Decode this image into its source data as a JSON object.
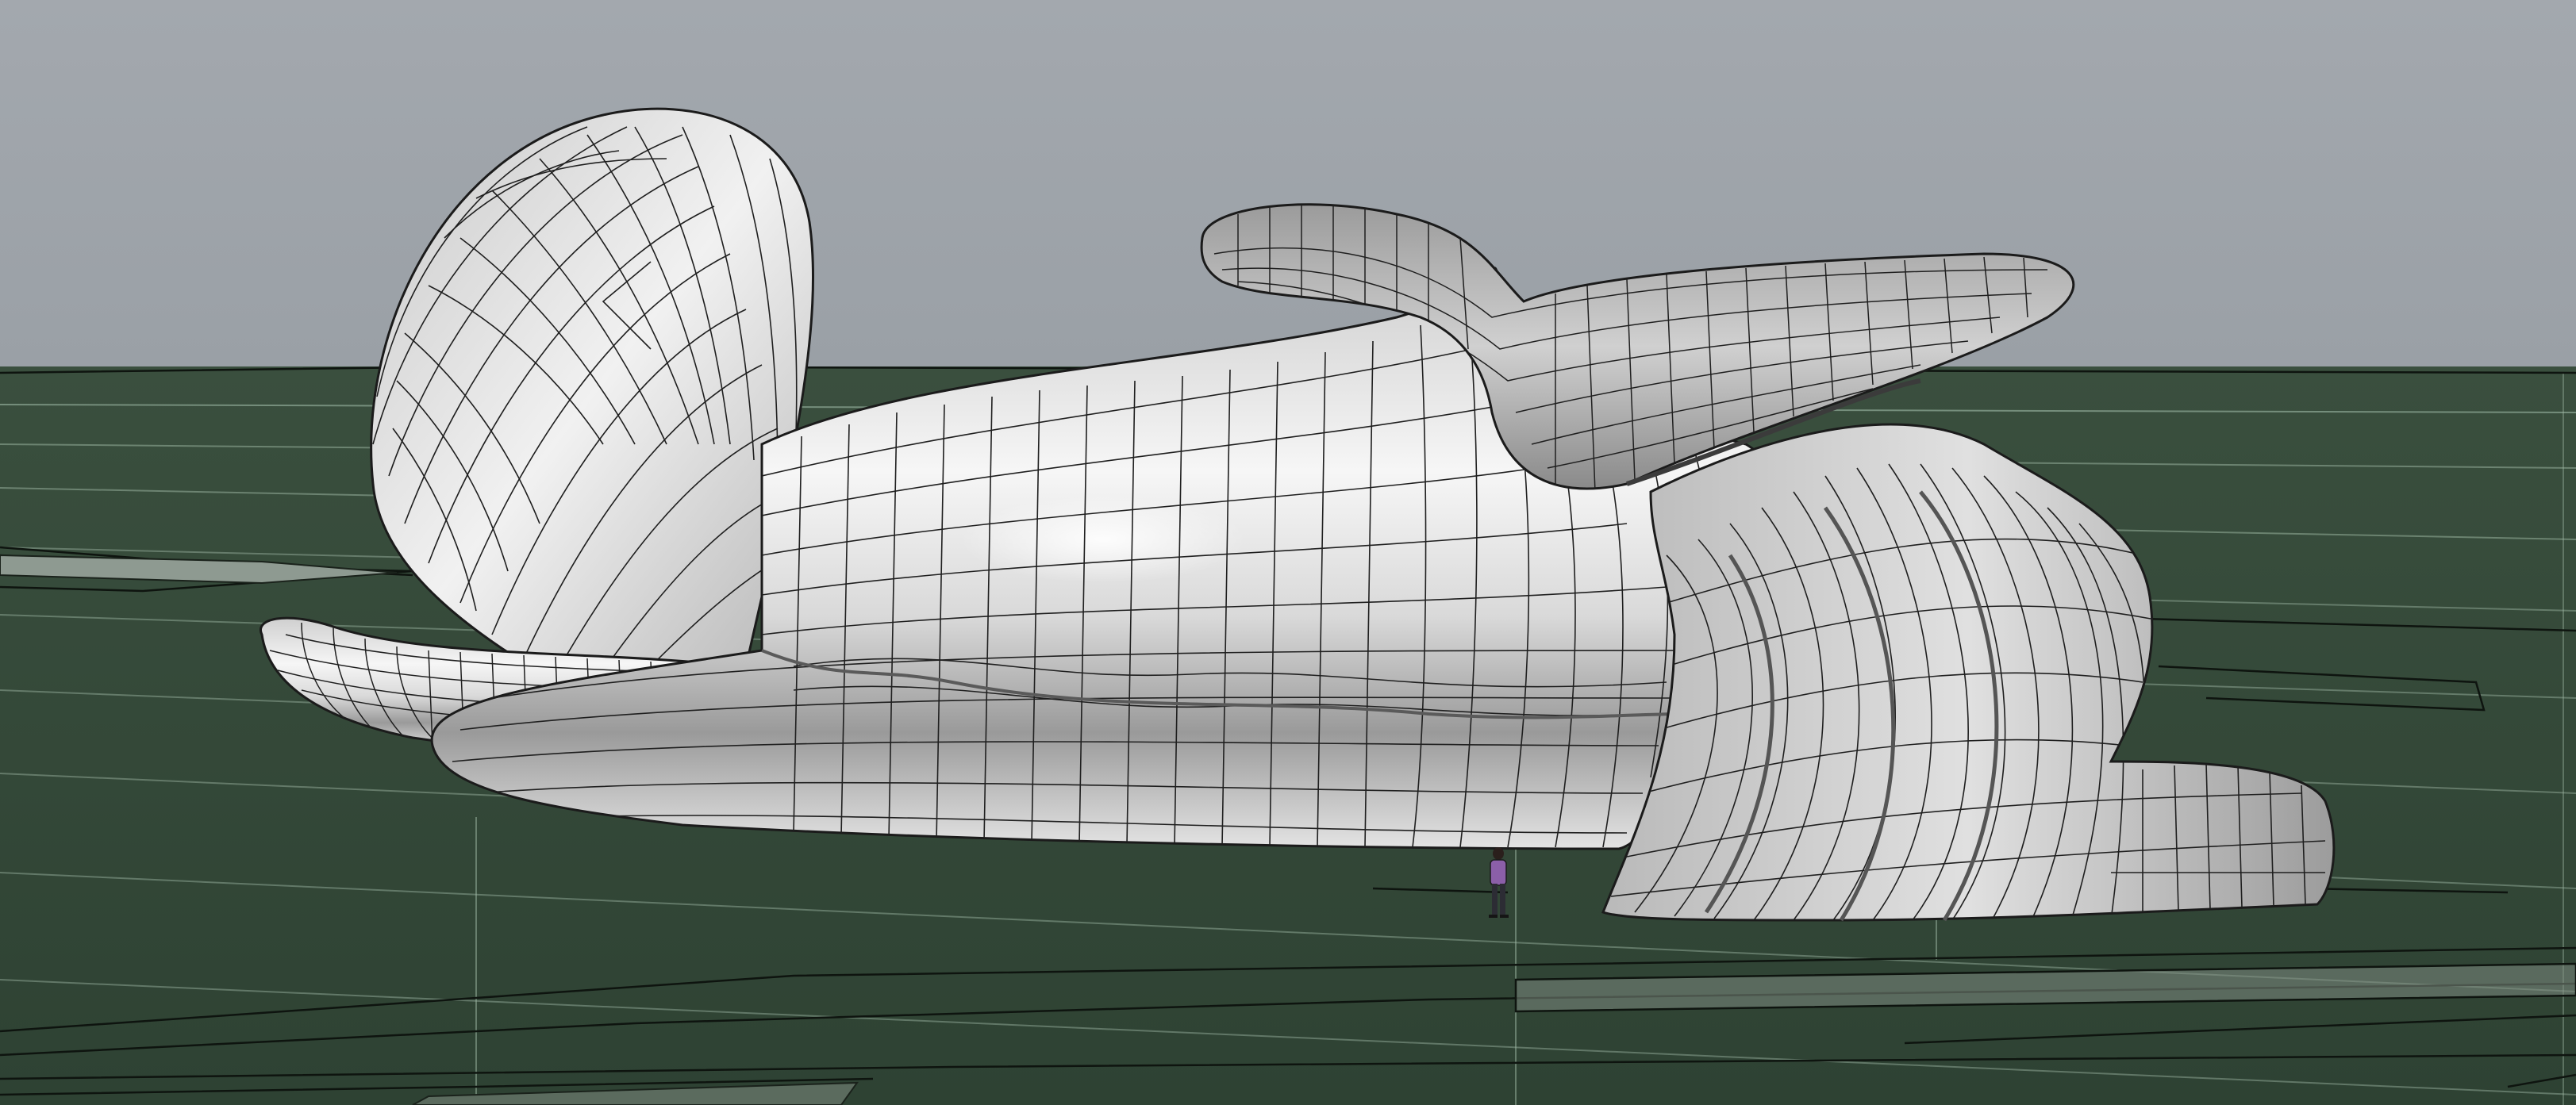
{
  "viewport": {
    "name": "perspective-3d-viewport",
    "shading": "shaded-with-isocurves",
    "scene_description": "nurbs-surface-model",
    "colors": {
      "sky": "#a0a5ab",
      "ground": "#344938",
      "surface_light": "#f2f2f2",
      "surface_mid": "#c9c9c9",
      "surface_dark": "#8e8e8e",
      "isocurve": "#1b1b1b",
      "ground_line_light": "#a9c4b0",
      "ground_line_dark": "#111611",
      "figure_shirt": "#8b5fa8"
    }
  }
}
